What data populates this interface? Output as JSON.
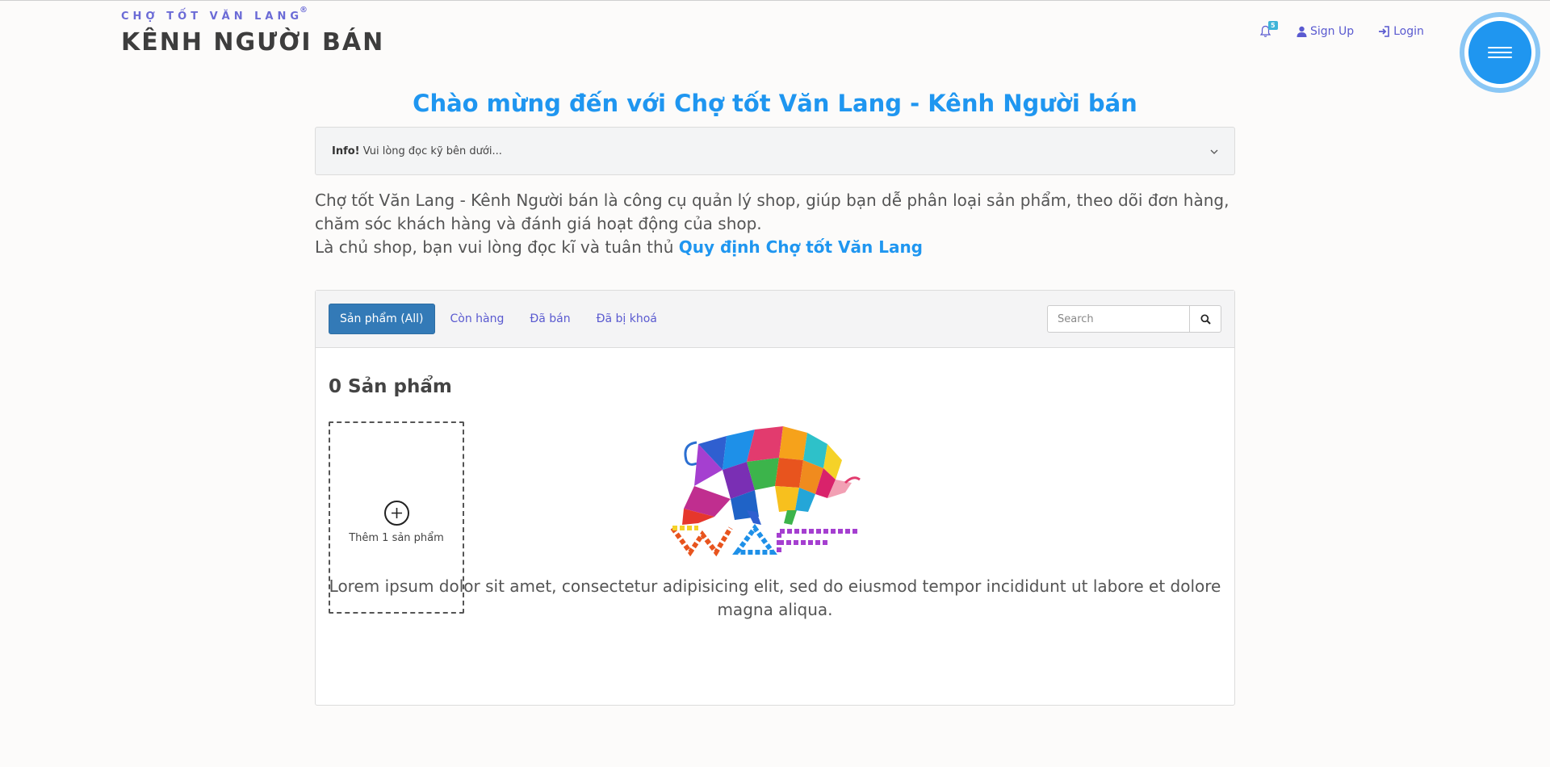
{
  "brand": {
    "subtitle": "CHỢ TỐT VĂN LANG",
    "registered": "®",
    "title": "KÊNH NGƯỜI BÁN"
  },
  "nav": {
    "notification_count": "5",
    "signup_label": "Sign Up",
    "login_label": "Login"
  },
  "main": {
    "welcome": "Chào mừng đến với Chợ tốt Văn Lang - Kênh Người bán",
    "info": {
      "label": "Info!",
      "text": "Vui lòng đọc kỹ bên dưới..."
    },
    "intro": {
      "line1": "Chợ tốt Văn Lang - Kênh Người bán là công cụ quản lý shop, giúp bạn dễ phân loại sản phẩm, theo dõi đơn hàng, chăm sóc khách hàng và đánh giá hoạt động của shop.",
      "line2_prefix": "Là chủ shop, bạn vui lòng đọc kĩ và tuân thủ",
      "rule_link": "Quy định Chợ tốt Văn Lang"
    }
  },
  "products": {
    "tabs": [
      {
        "label": "Sản phẩm (All)",
        "active": true
      },
      {
        "label": "Còn hàng",
        "active": false
      },
      {
        "label": "Đã bán",
        "active": false
      },
      {
        "label": "Đã bị khoá",
        "active": false
      }
    ],
    "search_placeholder": "Search",
    "count_label": "0 Sản phẩm",
    "add_label": "Thêm 1 sản phẩm",
    "description": "Lorem ipsum dolor sit amet, consectetur adipisicing elit, sed do eiusmod tempor incididunt ut labore et dolore magna aliqua."
  },
  "colors": {
    "accent": "#1f96f0",
    "link": "#5a5ad0",
    "active_tab": "#337ab7"
  }
}
